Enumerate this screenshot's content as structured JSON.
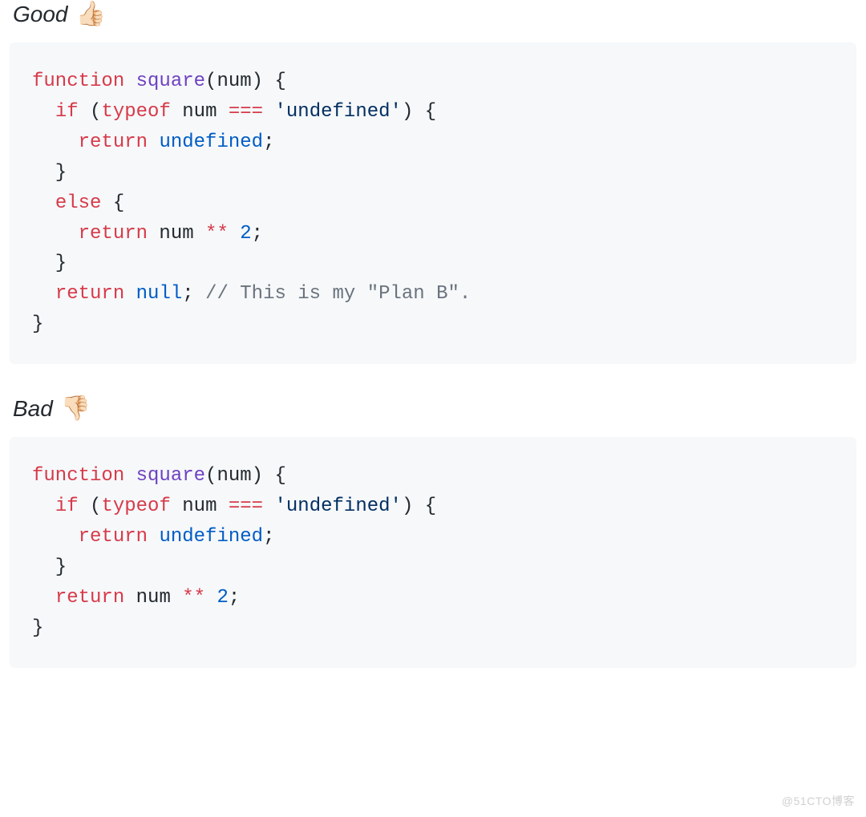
{
  "sections": [
    {
      "label": "Good",
      "emoji": "👍🏻",
      "code": [
        [
          {
            "t": "function",
            "c": "kw"
          },
          {
            "t": " "
          },
          {
            "t": "square",
            "c": "fn"
          },
          {
            "t": "("
          },
          {
            "t": "num"
          },
          {
            "t": ") {"
          }
        ],
        [
          {
            "t": "  "
          },
          {
            "t": "if",
            "c": "kw"
          },
          {
            "t": " ("
          },
          {
            "t": "typeof",
            "c": "kw"
          },
          {
            "t": " num "
          },
          {
            "t": "===",
            "c": "kw"
          },
          {
            "t": " "
          },
          {
            "t": "'undefined'",
            "c": "str"
          },
          {
            "t": ") {"
          }
        ],
        [
          {
            "t": "    "
          },
          {
            "t": "return",
            "c": "kw"
          },
          {
            "t": " "
          },
          {
            "t": "undefined",
            "c": "lit"
          },
          {
            "t": ";"
          }
        ],
        [
          {
            "t": "  }"
          }
        ],
        [
          {
            "t": "  "
          },
          {
            "t": "else",
            "c": "kw"
          },
          {
            "t": " {"
          }
        ],
        [
          {
            "t": "    "
          },
          {
            "t": "return",
            "c": "kw"
          },
          {
            "t": " num "
          },
          {
            "t": "**",
            "c": "kw"
          },
          {
            "t": " "
          },
          {
            "t": "2",
            "c": "num"
          },
          {
            "t": ";"
          }
        ],
        [
          {
            "t": "  }"
          }
        ],
        [
          {
            "t": "  "
          },
          {
            "t": "return",
            "c": "kw"
          },
          {
            "t": " "
          },
          {
            "t": "null",
            "c": "lit"
          },
          {
            "t": "; "
          },
          {
            "t": "// This is my \"Plan B\".",
            "c": "com"
          }
        ],
        [
          {
            "t": "}"
          }
        ]
      ]
    },
    {
      "label": "Bad",
      "emoji": "👎🏻",
      "code": [
        [
          {
            "t": "function",
            "c": "kw"
          },
          {
            "t": " "
          },
          {
            "t": "square",
            "c": "fn"
          },
          {
            "t": "("
          },
          {
            "t": "num"
          },
          {
            "t": ") {"
          }
        ],
        [
          {
            "t": "  "
          },
          {
            "t": "if",
            "c": "kw"
          },
          {
            "t": " ("
          },
          {
            "t": "typeof",
            "c": "kw"
          },
          {
            "t": " num "
          },
          {
            "t": "===",
            "c": "kw"
          },
          {
            "t": " "
          },
          {
            "t": "'undefined'",
            "c": "str"
          },
          {
            "t": ") {"
          }
        ],
        [
          {
            "t": "    "
          },
          {
            "t": "return",
            "c": "kw"
          },
          {
            "t": " "
          },
          {
            "t": "undefined",
            "c": "lit"
          },
          {
            "t": ";"
          }
        ],
        [
          {
            "t": "  }"
          }
        ],
        [
          {
            "t": "  "
          },
          {
            "t": "return",
            "c": "kw"
          },
          {
            "t": " num "
          },
          {
            "t": "**",
            "c": "kw"
          },
          {
            "t": " "
          },
          {
            "t": "2",
            "c": "num"
          },
          {
            "t": ";"
          }
        ],
        [
          {
            "t": "}"
          }
        ]
      ]
    }
  ],
  "watermark": "@51CTO博客"
}
